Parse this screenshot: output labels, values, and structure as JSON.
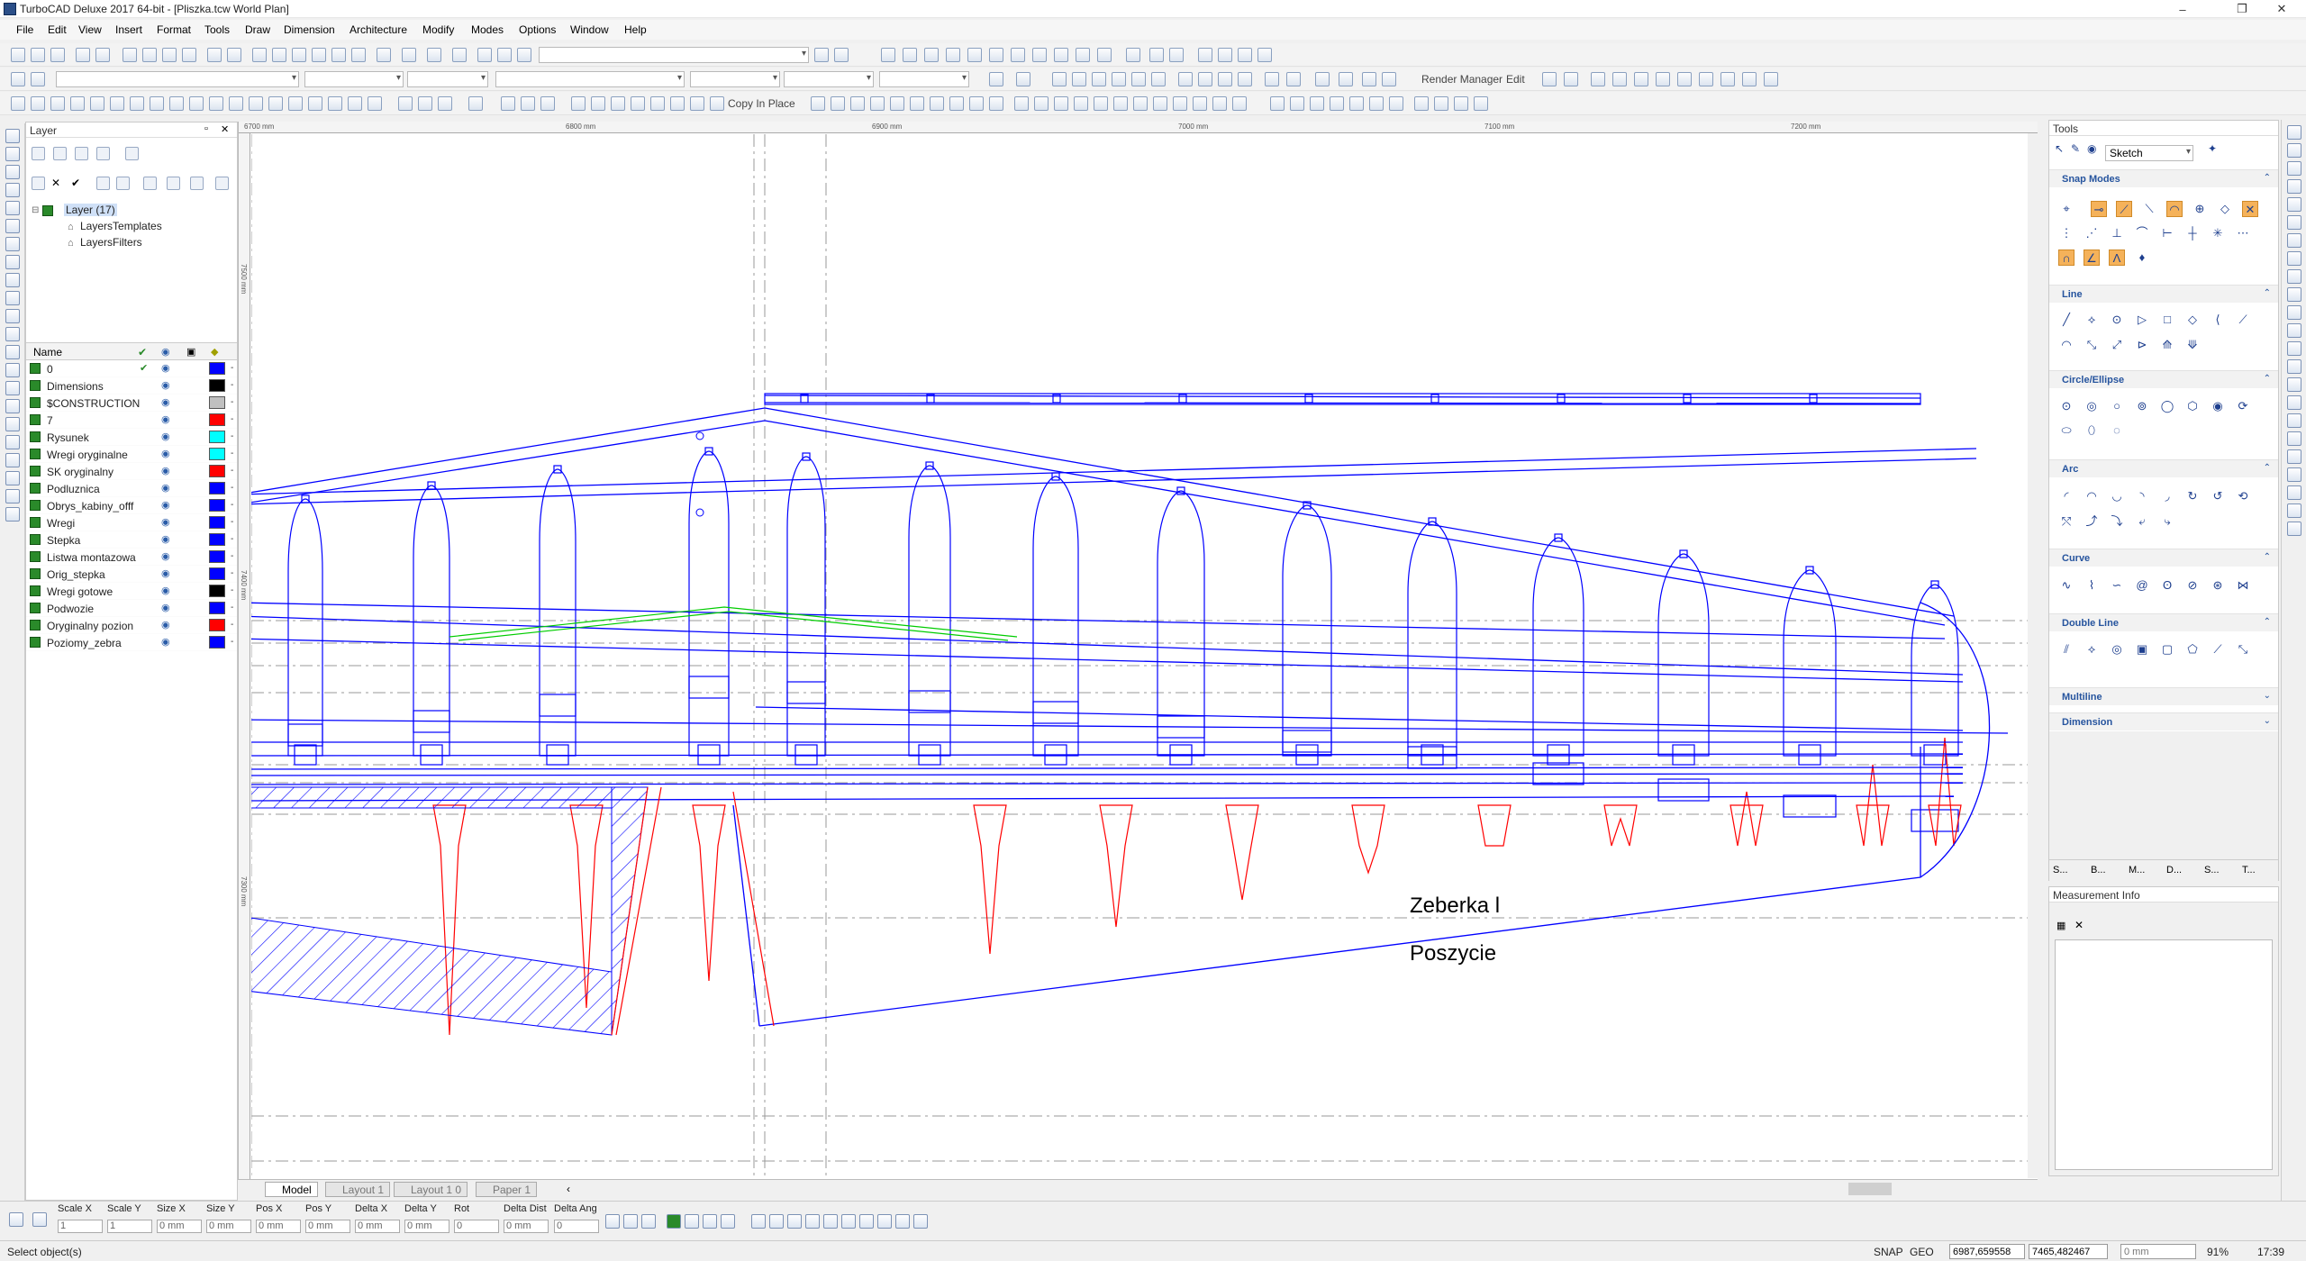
{
  "window": {
    "title": "TurboCAD Deluxe 2017 64-bit - [Pliszka.tcw World Plan]",
    "controls": [
      "–",
      "❐",
      "✕"
    ]
  },
  "menu": [
    "File",
    "Edit",
    "View",
    "Insert",
    "Format",
    "Tools",
    "Draw",
    "Dimension",
    "Architecture",
    "Modify",
    "Modes",
    "Options",
    "Window",
    "Help"
  ],
  "toolbar": {
    "copy_in_place": "Copy In Place",
    "render_manager": "Render Manager",
    "edit": "Edit"
  },
  "layer_panel": {
    "title": "Layer",
    "tree": {
      "root": "Layer (17)",
      "children": [
        "LayersTemplates",
        "LayersFilters"
      ]
    },
    "columns": [
      "Name"
    ],
    "rows": [
      {
        "name": "0",
        "color": "#0000ff",
        "visible_check": true
      },
      {
        "name": "Dimensions",
        "color": "#000000"
      },
      {
        "name": "$CONSTRUCTION",
        "color": "#c0c0c0"
      },
      {
        "name": "7",
        "color": "#ff0000"
      },
      {
        "name": "Rysunek",
        "color": "#00ffff"
      },
      {
        "name": "Wregi oryginalne",
        "color": "#00ffff"
      },
      {
        "name": "SK oryginalny",
        "color": "#ff0000"
      },
      {
        "name": "Podluznica",
        "color": "#0000ff"
      },
      {
        "name": "Obrys_kabiny_offf",
        "color": "#0000ff"
      },
      {
        "name": "Wregi",
        "color": "#0000ff"
      },
      {
        "name": "Stepka",
        "color": "#0000ff"
      },
      {
        "name": "Listwa montazowa",
        "color": "#0000ff"
      },
      {
        "name": "Orig_stepka",
        "color": "#0000ff"
      },
      {
        "name": "Wregi gotowe",
        "color": "#000000"
      },
      {
        "name": "Podwozie",
        "color": "#0000ff"
      },
      {
        "name": "Oryginalny pozion",
        "color": "#ff0000"
      },
      {
        "name": "Poziomy_zebra",
        "color": "#0000ff"
      }
    ]
  },
  "rulers": {
    "top": [
      "6700 mm",
      "6800 mm",
      "6900 mm",
      "7000 mm",
      "7100 mm",
      "7200 mm"
    ],
    "left": [
      "7500 mm",
      "7400 mm",
      "7300 mm"
    ]
  },
  "canvas_text": {
    "label1": "Zeberka l",
    "label2": "Poszycie"
  },
  "tabs": [
    "Model",
    "Layout 1",
    "Layout 1 0",
    "Paper 1"
  ],
  "tools_panel": {
    "title": "Tools",
    "mode": "Sketch",
    "sections": [
      "Snap Modes",
      "Line",
      "Circle/Ellipse",
      "Arc",
      "Curve",
      "Double Line",
      "Multiline",
      "Dimension"
    ],
    "bottom_tabs": [
      "S...",
      "B...",
      "M...",
      "D...",
      "S...",
      "T..."
    ]
  },
  "measure_panel": {
    "title": "Measurement Info"
  },
  "inspector": {
    "fields": [
      {
        "label": "Scale X",
        "value": "1"
      },
      {
        "label": "Scale Y",
        "value": "1"
      },
      {
        "label": "Size X",
        "value": "0 mm"
      },
      {
        "label": "Size Y",
        "value": "0 mm"
      },
      {
        "label": "Pos X",
        "value": "0 mm"
      },
      {
        "label": "Pos Y",
        "value": "0 mm"
      },
      {
        "label": "Delta X",
        "value": "0 mm"
      },
      {
        "label": "Delta Y",
        "value": "0 mm"
      },
      {
        "label": "Rot",
        "value": "0"
      },
      {
        "label": "Delta Dist",
        "value": "0 mm"
      },
      {
        "label": "Delta Ang",
        "value": "0"
      }
    ]
  },
  "status": {
    "message": "Select object(s)",
    "snap": "SNAP",
    "geo": "GEO",
    "x": "6987,659558",
    "y": "7465,482467",
    "z": "0 mm",
    "zoom": "91%",
    "time": "17:39"
  },
  "colors": {
    "accent": "#26549e",
    "drawing_blue": "#0000ff",
    "drawing_red": "#ff0000",
    "drawing_green": "#00cc00"
  }
}
